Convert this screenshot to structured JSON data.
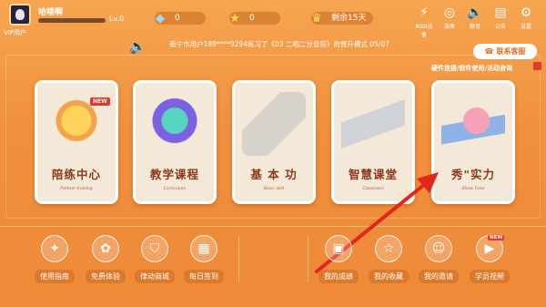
{
  "header": {
    "username": "哈喽啊",
    "vip_label": "VIP用户",
    "level": "Lv.0",
    "diamonds": "0",
    "stars": "0",
    "remaining": "剩余15天",
    "icons": [
      {
        "name": "midi-icon",
        "label": "MIDI设备"
      },
      {
        "name": "performance-icon",
        "label": "演奏"
      },
      {
        "name": "mute-icon",
        "label": "静音"
      },
      {
        "name": "announcement-icon",
        "label": "公告"
      },
      {
        "name": "settings-icon",
        "label": "设置"
      }
    ]
  },
  "notice": {
    "text": "南宁市用户189****9294练习了《03 二哂二分音符》的晋升模式 05/07"
  },
  "service": {
    "button": "联系客服",
    "support_link": "硬件连接/软件使用/活动咨询"
  },
  "cards": [
    {
      "title": "陪练中心",
      "subtitle": "Partner training",
      "badge": "NEW"
    },
    {
      "title": "教学课程",
      "subtitle": "Curriculum"
    },
    {
      "title": "基 本 功",
      "subtitle": "Basic skill"
    },
    {
      "title": "智慧课堂",
      "subtitle": "Classroom"
    },
    {
      "title": "秀\"实力",
      "subtitle": "Show Time"
    }
  ],
  "bottom_left": [
    {
      "label": "使用指南",
      "icon": "compass-icon"
    },
    {
      "label": "免费体验",
      "icon": "gift-icon"
    },
    {
      "label": "律动商城",
      "icon": "shopping-bag-icon"
    },
    {
      "label": "每日签到",
      "icon": "calendar-icon"
    }
  ],
  "bottom_right": [
    {
      "label": "我的成绩",
      "icon": "report-icon"
    },
    {
      "label": "我的收藏",
      "icon": "star-icon"
    },
    {
      "label": "我的邀请",
      "icon": "person-icon"
    },
    {
      "label": "学员视频",
      "icon": "video-icon",
      "badge": "NEW"
    }
  ],
  "colors": {
    "background": "#f08f3d",
    "card_bg": "#f4e9d8",
    "card_title": "#8a3a18",
    "arrow": "#e3261c"
  }
}
